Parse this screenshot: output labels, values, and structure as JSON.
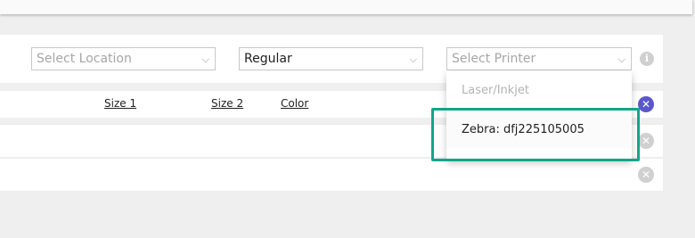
{
  "filters": {
    "location": {
      "placeholder": "Select Location",
      "chevron": "⌵"
    },
    "type": {
      "value": "Regular",
      "chevron": "⌵"
    },
    "printer": {
      "placeholder": "Select Printer",
      "chevron": "⌵"
    },
    "info_glyph": "i"
  },
  "table": {
    "columns": [
      "Size 1",
      "Size 2",
      "Color"
    ],
    "remove_glyph": "✕"
  },
  "printer_dropdown": {
    "options": [
      {
        "label": "Laser/Inkjet",
        "state": "disabled"
      },
      {
        "label": "Zebra: dfj225105005",
        "state": "hover"
      }
    ]
  },
  "colors": {
    "accent_purple": "#5a58c9",
    "highlight_teal": "#14a58a",
    "muted_gray": "#d0d0d0"
  },
  "icons": {
    "info": "info-icon",
    "remove": "close-circle-icon",
    "chevron": "chevron-down-icon"
  }
}
